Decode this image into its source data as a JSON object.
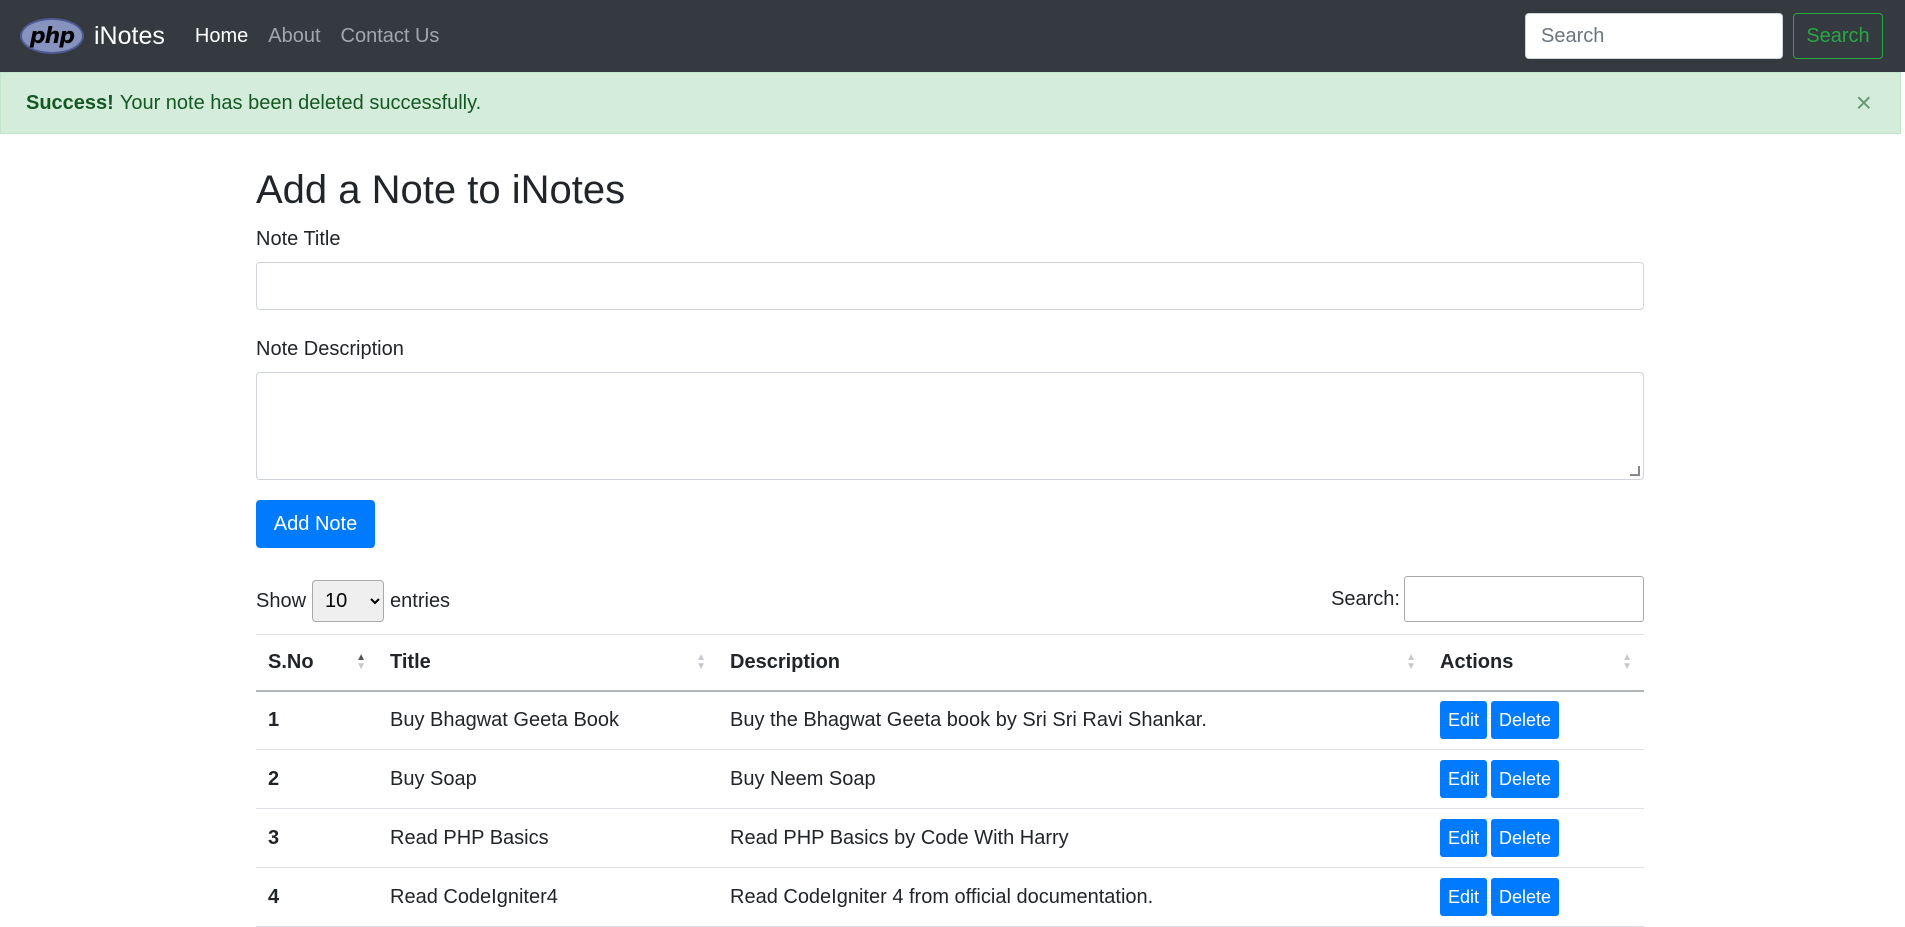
{
  "navbar": {
    "logo_text": "php",
    "brand": "iNotes",
    "links": [
      "Home",
      "About",
      "Contact Us"
    ],
    "search_placeholder": "Search",
    "search_button": "Search"
  },
  "alert": {
    "strong": "Success!",
    "message": "Your note has been deleted successfully.",
    "close": "×"
  },
  "form": {
    "heading": "Add a Note to iNotes",
    "title_label": "Note Title",
    "description_label": "Note Description",
    "submit": "Add Note"
  },
  "datatable": {
    "show_label": "Show",
    "entries_value": "10",
    "entries_label": "entries",
    "search_label": "Search:",
    "columns": [
      "S.No",
      "Title",
      "Description",
      "Actions"
    ],
    "rows": [
      {
        "sno": "1",
        "title": "Buy Bhagwat Geeta Book",
        "description": "Buy the Bhagwat Geeta book by Sri Sri Ravi Shankar."
      },
      {
        "sno": "2",
        "title": "Buy Soap",
        "description": "Buy Neem Soap"
      },
      {
        "sno": "3",
        "title": "Read PHP Basics",
        "description": "Read PHP Basics by Code With Harry"
      },
      {
        "sno": "4",
        "title": "Read CodeIgniter4",
        "description": "Read CodeIgniter 4 from official documentation."
      }
    ],
    "edit_label": "Edit",
    "delete_label": "Delete"
  },
  "colors": {
    "navbar": "#343a40",
    "primary": "#007bff",
    "success": "#28a745",
    "alert_bg": "#d4edda"
  }
}
